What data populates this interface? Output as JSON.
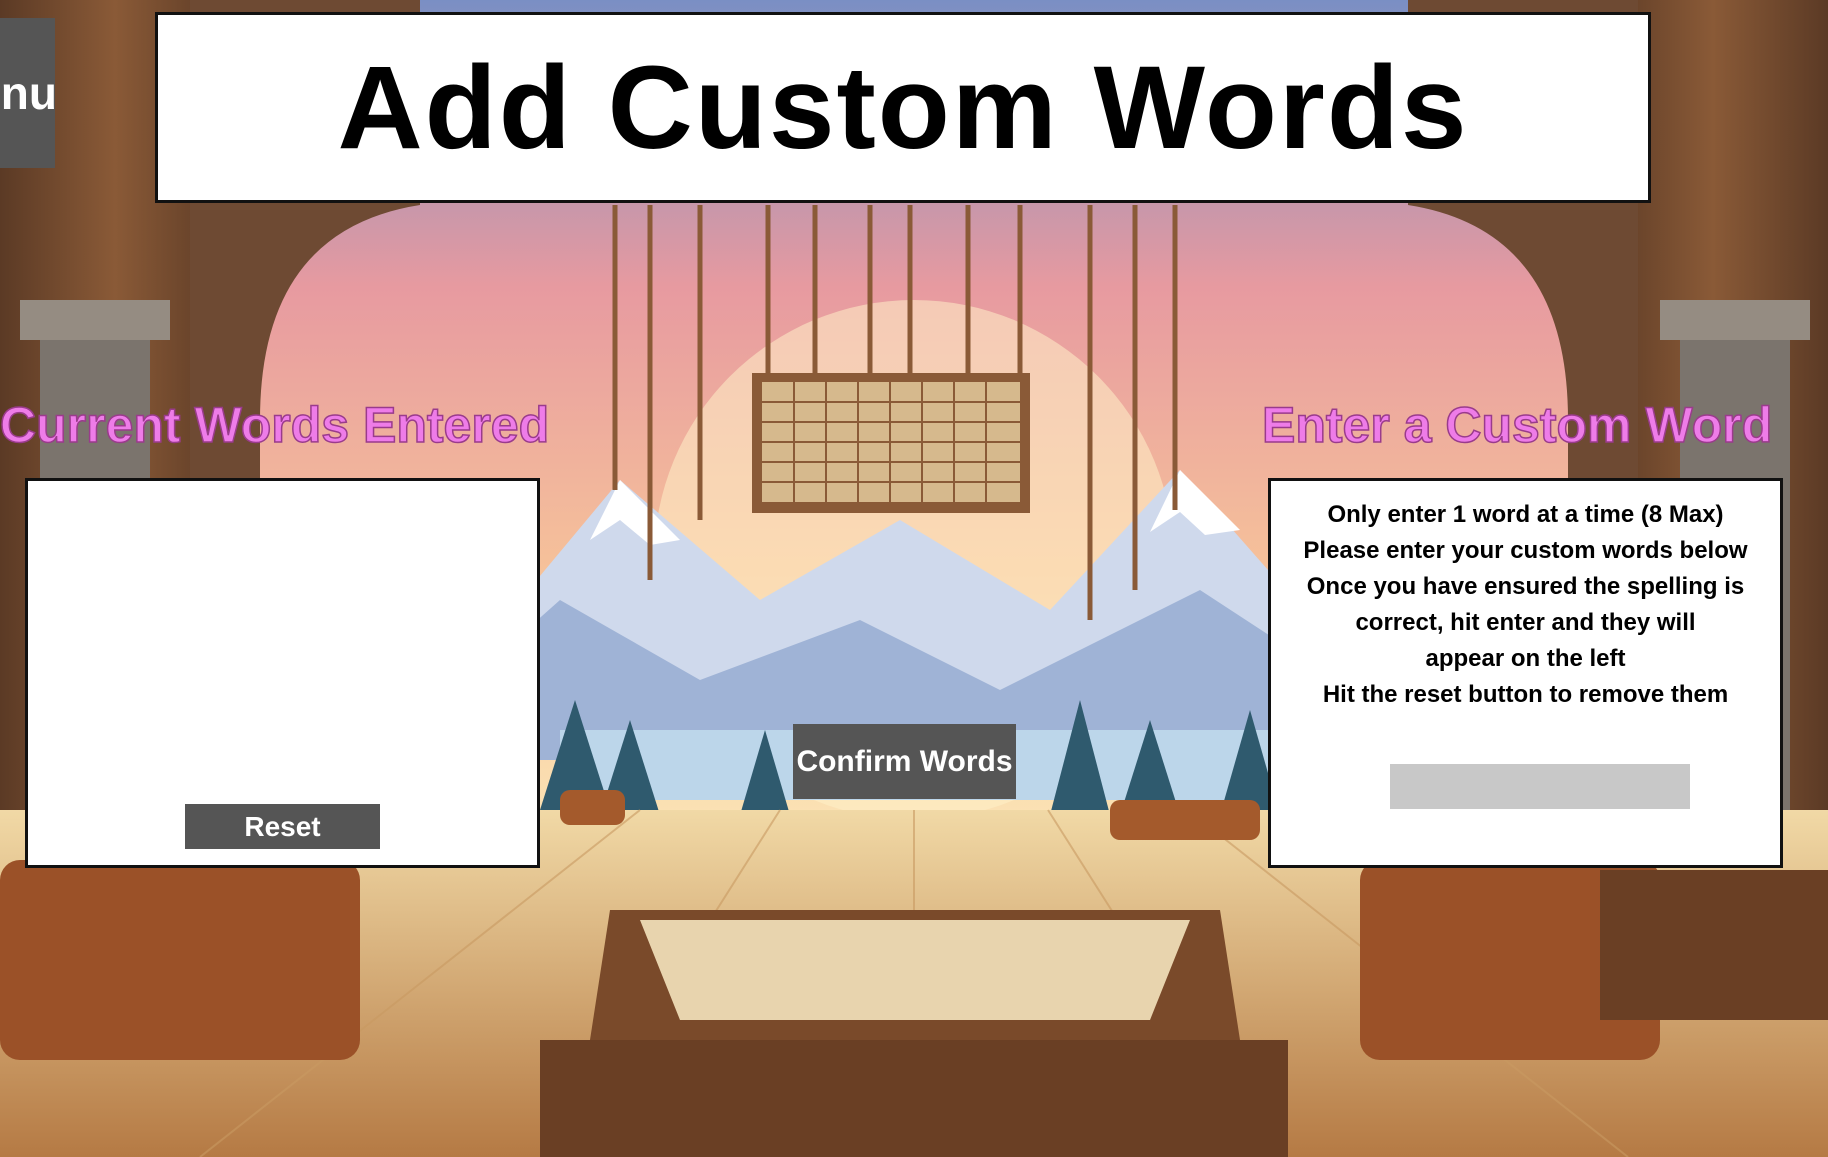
{
  "menu": {
    "label": "Menu"
  },
  "title": "Add Custom Words",
  "current_words": {
    "heading": "Current Words Entered",
    "words": [],
    "reset_label": "Reset"
  },
  "custom_word": {
    "heading": "Enter a Custom Word",
    "instructions": [
      "Only enter 1 word at a time (8 Max)",
      "Please enter your custom words below",
      "Once you have ensured the spelling is",
      "correct, hit enter and they will",
      "appear on the left",
      "Hit the reset button to remove them"
    ],
    "input_value": ""
  },
  "confirm_label": "Confirm Words",
  "colors": {
    "heading": "#ee7ce8",
    "button": "#555555",
    "input": "#c8c8c8"
  }
}
